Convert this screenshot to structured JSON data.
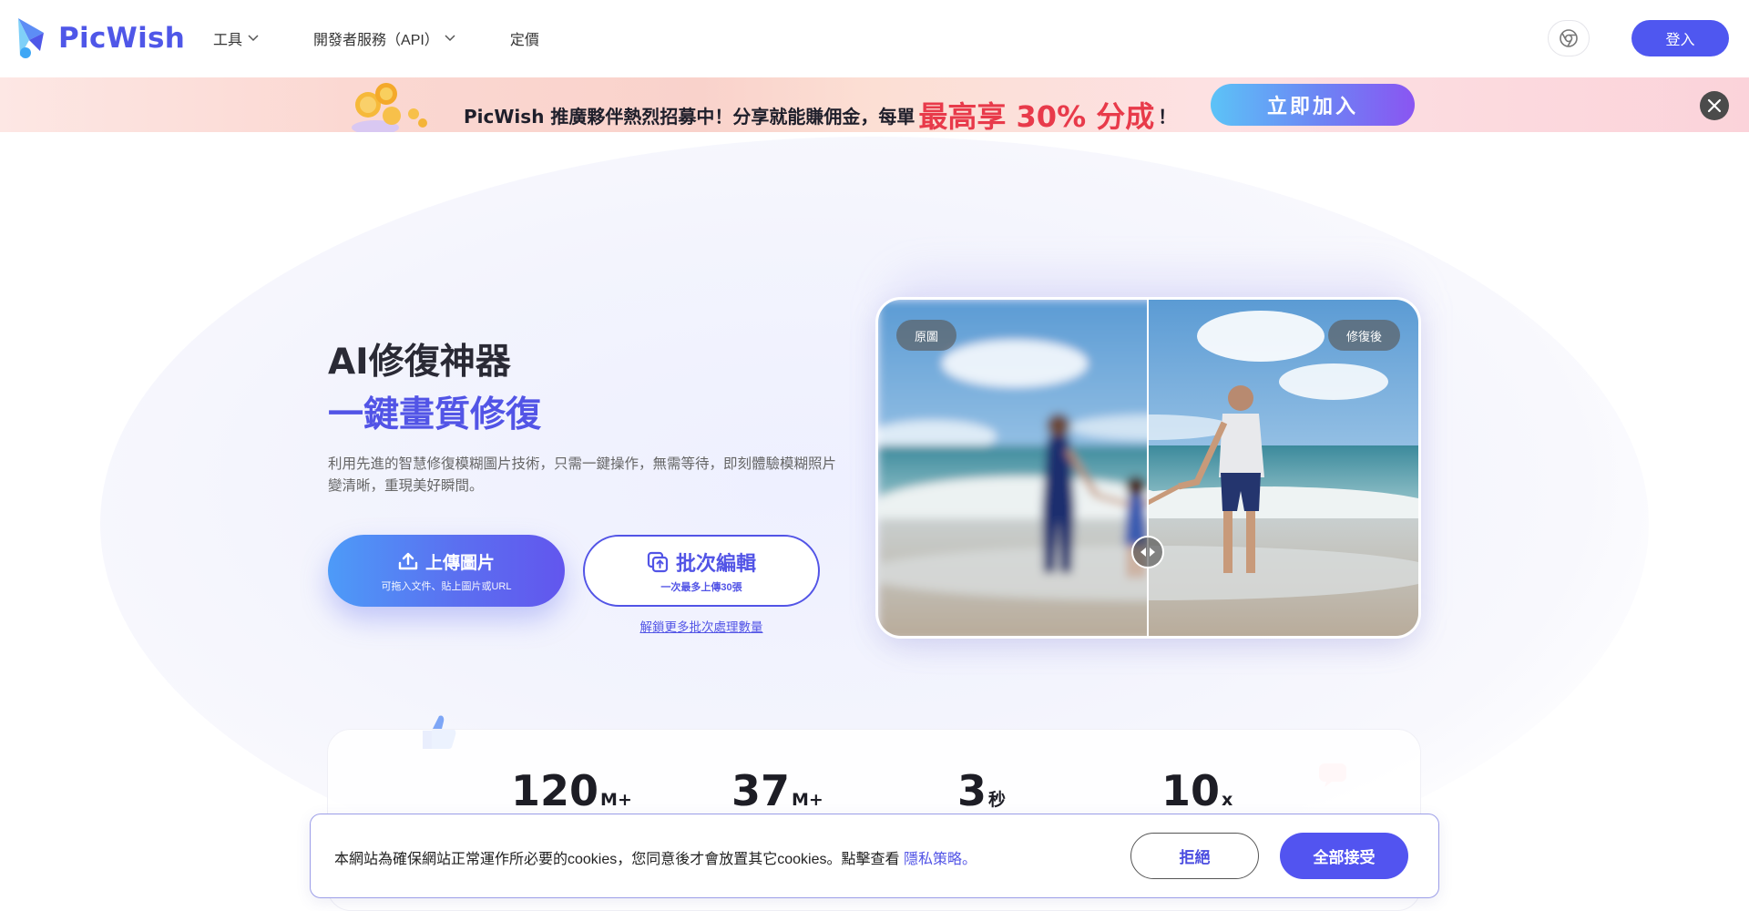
{
  "brand": {
    "name": "PicWish",
    "accent": "#4f57e8"
  },
  "nav": {
    "items": [
      {
        "label": "工具",
        "has_dropdown": true
      },
      {
        "label": "開發者服務（API）",
        "has_dropdown": true
      },
      {
        "label": "定價",
        "has_dropdown": false
      }
    ]
  },
  "header": {
    "extension_icon": "chrome-icon",
    "login_label": "登入"
  },
  "promo": {
    "text_before": "PicWish 推廣夥伴熱烈招募中！分享就能賺佣金，每單",
    "highlight": "最高享 30% 分成",
    "text_after": "！",
    "join_label": "立即加入",
    "highlight_color": "#e83a4a"
  },
  "hero": {
    "title_line1": "AI修復神器",
    "title_line2": "一鍵畫質修復",
    "description": "利用先進的智慧修復模糊圖片技術，只需一鍵操作，無需等待，即刻體驗模糊照片變清晰，重現美好瞬間。",
    "upload_label": "上傳圖片",
    "upload_sub": "可拖入文件、貼上圖片或URL",
    "batch_label": "批次編輯",
    "batch_sub": "一次最多上傳30張",
    "unlock_link": "解鎖更多批次處理數量"
  },
  "compare": {
    "before_label": "原圖",
    "after_label": "修復後"
  },
  "stats": [
    {
      "value": "120",
      "unit": "M+"
    },
    {
      "value": "37",
      "unit": "M+"
    },
    {
      "value": "3",
      "unit": "秒"
    },
    {
      "value": "10",
      "unit": "x"
    }
  ],
  "cookie": {
    "text": "本網站為確保網站正常運作所必要的cookies，您同意後才會放置其它cookies。點擊查看",
    "link": "隱私策略。",
    "reject_label": "拒絕",
    "accept_label": "全部接受"
  }
}
